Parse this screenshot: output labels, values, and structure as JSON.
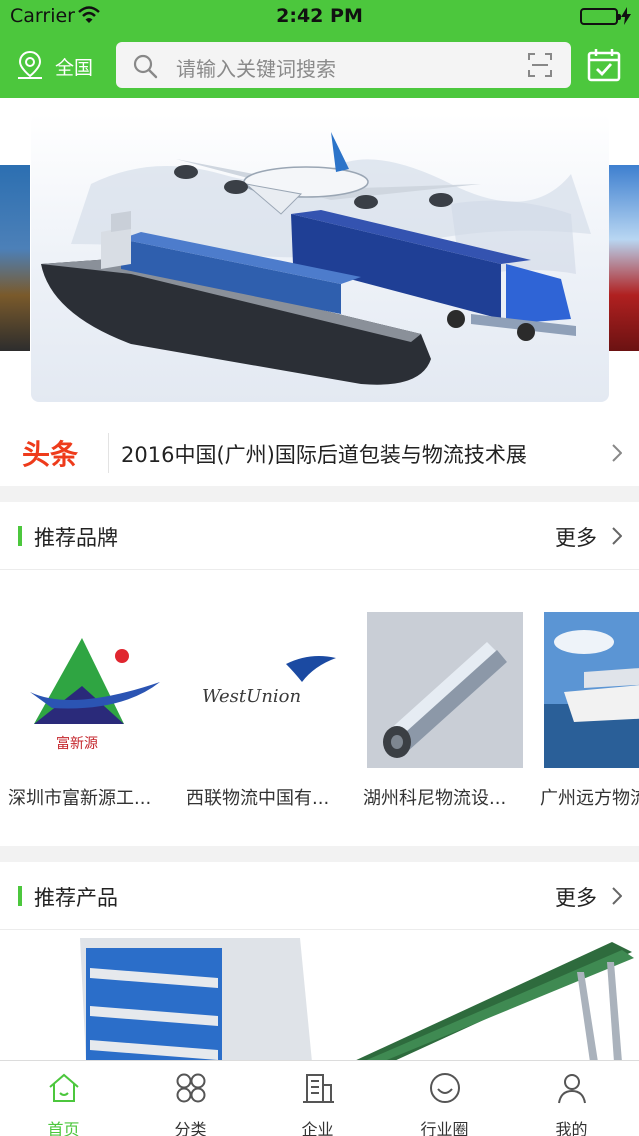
{
  "status_bar": {
    "carrier": "Carrier",
    "time": "2:42 PM"
  },
  "header": {
    "location": "全国",
    "search_placeholder": "请输入关键词搜索"
  },
  "headline": {
    "tag": "头条",
    "text": "2016中国(广州)国际后道包装与物流技术展"
  },
  "brands": {
    "title": "推荐品牌",
    "more": "更多",
    "items": [
      {
        "name": "深圳市富新源工...",
        "logo_text": "富新源"
      },
      {
        "name": "西联物流中国有...",
        "logo_text": "WestUnion"
      },
      {
        "name": "湖州科尼物流设..."
      },
      {
        "name": "广州远方物流"
      }
    ]
  },
  "products": {
    "title": "推荐产品",
    "more": "更多"
  },
  "tabs": [
    {
      "label": "首页",
      "icon": "home-icon",
      "active": true
    },
    {
      "label": "分类",
      "icon": "category-icon"
    },
    {
      "label": "企业",
      "icon": "company-icon"
    },
    {
      "label": "行业圈",
      "icon": "circle-icon"
    },
    {
      "label": "我的",
      "icon": "user-icon"
    }
  ],
  "colors": {
    "primary": "#4cc73d",
    "headline_red": "#ee3b1b"
  }
}
